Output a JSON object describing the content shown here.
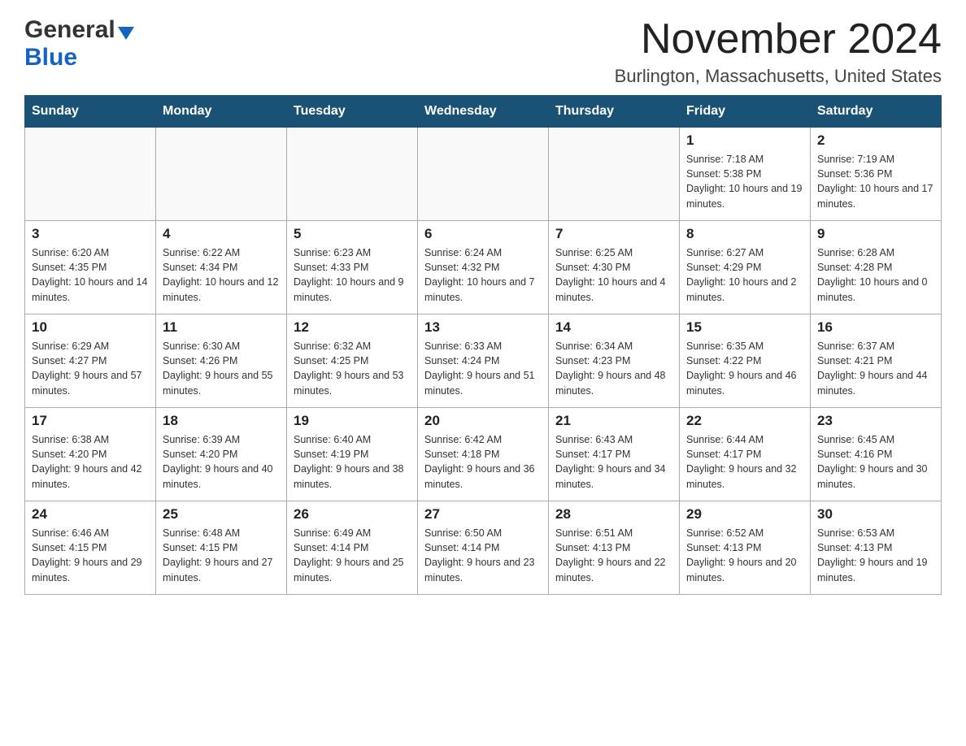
{
  "logo": {
    "text_general": "General",
    "text_blue": "Blue"
  },
  "title": "November 2024",
  "subtitle": "Burlington, Massachusetts, United States",
  "days_of_week": [
    "Sunday",
    "Monday",
    "Tuesday",
    "Wednesday",
    "Thursday",
    "Friday",
    "Saturday"
  ],
  "weeks": [
    [
      {
        "day": "",
        "info": ""
      },
      {
        "day": "",
        "info": ""
      },
      {
        "day": "",
        "info": ""
      },
      {
        "day": "",
        "info": ""
      },
      {
        "day": "",
        "info": ""
      },
      {
        "day": "1",
        "info": "Sunrise: 7:18 AM\nSunset: 5:38 PM\nDaylight: 10 hours and 19 minutes."
      },
      {
        "day": "2",
        "info": "Sunrise: 7:19 AM\nSunset: 5:36 PM\nDaylight: 10 hours and 17 minutes."
      }
    ],
    [
      {
        "day": "3",
        "info": "Sunrise: 6:20 AM\nSunset: 4:35 PM\nDaylight: 10 hours and 14 minutes."
      },
      {
        "day": "4",
        "info": "Sunrise: 6:22 AM\nSunset: 4:34 PM\nDaylight: 10 hours and 12 minutes."
      },
      {
        "day": "5",
        "info": "Sunrise: 6:23 AM\nSunset: 4:33 PM\nDaylight: 10 hours and 9 minutes."
      },
      {
        "day": "6",
        "info": "Sunrise: 6:24 AM\nSunset: 4:32 PM\nDaylight: 10 hours and 7 minutes."
      },
      {
        "day": "7",
        "info": "Sunrise: 6:25 AM\nSunset: 4:30 PM\nDaylight: 10 hours and 4 minutes."
      },
      {
        "day": "8",
        "info": "Sunrise: 6:27 AM\nSunset: 4:29 PM\nDaylight: 10 hours and 2 minutes."
      },
      {
        "day": "9",
        "info": "Sunrise: 6:28 AM\nSunset: 4:28 PM\nDaylight: 10 hours and 0 minutes."
      }
    ],
    [
      {
        "day": "10",
        "info": "Sunrise: 6:29 AM\nSunset: 4:27 PM\nDaylight: 9 hours and 57 minutes."
      },
      {
        "day": "11",
        "info": "Sunrise: 6:30 AM\nSunset: 4:26 PM\nDaylight: 9 hours and 55 minutes."
      },
      {
        "day": "12",
        "info": "Sunrise: 6:32 AM\nSunset: 4:25 PM\nDaylight: 9 hours and 53 minutes."
      },
      {
        "day": "13",
        "info": "Sunrise: 6:33 AM\nSunset: 4:24 PM\nDaylight: 9 hours and 51 minutes."
      },
      {
        "day": "14",
        "info": "Sunrise: 6:34 AM\nSunset: 4:23 PM\nDaylight: 9 hours and 48 minutes."
      },
      {
        "day": "15",
        "info": "Sunrise: 6:35 AM\nSunset: 4:22 PM\nDaylight: 9 hours and 46 minutes."
      },
      {
        "day": "16",
        "info": "Sunrise: 6:37 AM\nSunset: 4:21 PM\nDaylight: 9 hours and 44 minutes."
      }
    ],
    [
      {
        "day": "17",
        "info": "Sunrise: 6:38 AM\nSunset: 4:20 PM\nDaylight: 9 hours and 42 minutes."
      },
      {
        "day": "18",
        "info": "Sunrise: 6:39 AM\nSunset: 4:20 PM\nDaylight: 9 hours and 40 minutes."
      },
      {
        "day": "19",
        "info": "Sunrise: 6:40 AM\nSunset: 4:19 PM\nDaylight: 9 hours and 38 minutes."
      },
      {
        "day": "20",
        "info": "Sunrise: 6:42 AM\nSunset: 4:18 PM\nDaylight: 9 hours and 36 minutes."
      },
      {
        "day": "21",
        "info": "Sunrise: 6:43 AM\nSunset: 4:17 PM\nDaylight: 9 hours and 34 minutes."
      },
      {
        "day": "22",
        "info": "Sunrise: 6:44 AM\nSunset: 4:17 PM\nDaylight: 9 hours and 32 minutes."
      },
      {
        "day": "23",
        "info": "Sunrise: 6:45 AM\nSunset: 4:16 PM\nDaylight: 9 hours and 30 minutes."
      }
    ],
    [
      {
        "day": "24",
        "info": "Sunrise: 6:46 AM\nSunset: 4:15 PM\nDaylight: 9 hours and 29 minutes."
      },
      {
        "day": "25",
        "info": "Sunrise: 6:48 AM\nSunset: 4:15 PM\nDaylight: 9 hours and 27 minutes."
      },
      {
        "day": "26",
        "info": "Sunrise: 6:49 AM\nSunset: 4:14 PM\nDaylight: 9 hours and 25 minutes."
      },
      {
        "day": "27",
        "info": "Sunrise: 6:50 AM\nSunset: 4:14 PM\nDaylight: 9 hours and 23 minutes."
      },
      {
        "day": "28",
        "info": "Sunrise: 6:51 AM\nSunset: 4:13 PM\nDaylight: 9 hours and 22 minutes."
      },
      {
        "day": "29",
        "info": "Sunrise: 6:52 AM\nSunset: 4:13 PM\nDaylight: 9 hours and 20 minutes."
      },
      {
        "day": "30",
        "info": "Sunrise: 6:53 AM\nSunset: 4:13 PM\nDaylight: 9 hours and 19 minutes."
      }
    ]
  ]
}
